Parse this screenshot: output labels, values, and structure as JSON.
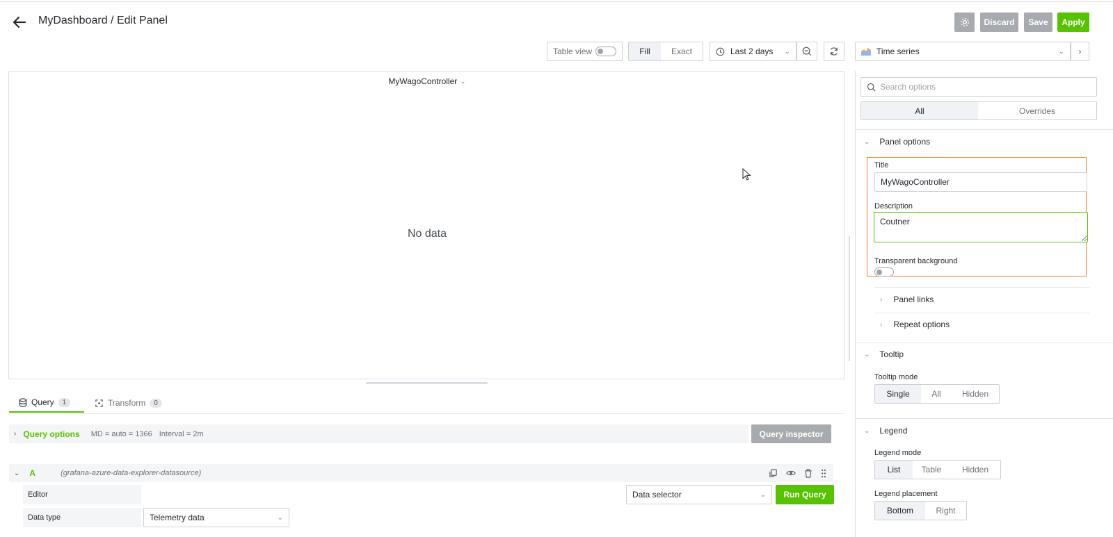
{
  "header": {
    "title": "MyDashboard / Edit Panel",
    "discard_label": "Discard",
    "save_label": "Save",
    "apply_label": "Apply"
  },
  "toolbar": {
    "table_view_label": "Table view",
    "fill_label": "Fill",
    "exact_label": "Exact",
    "time_range": "Last 2 days",
    "visualization": "Time series"
  },
  "panel": {
    "title": "MyWagoController",
    "no_data": "No data"
  },
  "tabs": [
    {
      "label": "Query",
      "count": "1"
    },
    {
      "label": "Transform",
      "count": "0"
    }
  ],
  "query_options": {
    "label": "Query options",
    "md": "MD = auto = 1366",
    "interval": "Interval = 2m",
    "inspector_label": "Query inspector"
  },
  "query": {
    "ref": "A",
    "datasource": "(grafana-azure-data-explorer-datasource)",
    "editor_label": "Editor",
    "data_selector": "Data selector",
    "run_label": "Run Query",
    "data_type_label": "Data type",
    "data_type_value": "Telemetry data"
  },
  "options": {
    "search_placeholder": "Search options",
    "tab_all": "All",
    "tab_overrides": "Overrides",
    "panel_options": {
      "header": "Panel options",
      "title_label": "Title",
      "title_value": "MyWagoController",
      "description_label": "Description",
      "description_value": "Coutner",
      "transparent_label": "Transparent background",
      "panel_links": "Panel links",
      "repeat_options": "Repeat options"
    },
    "tooltip": {
      "header": "Tooltip",
      "mode_label": "Tooltip mode",
      "modes": [
        "Single",
        "All",
        "Hidden"
      ]
    },
    "legend": {
      "header": "Legend",
      "mode_label": "Legend mode",
      "modes": [
        "List",
        "Table",
        "Hidden"
      ],
      "placement_label": "Legend placement",
      "placements": [
        "Bottom",
        "Right"
      ]
    }
  },
  "colors": {
    "accent_green": "#56c200",
    "highlight_orange": "#f07d21",
    "tab_underline": "#56c200"
  }
}
